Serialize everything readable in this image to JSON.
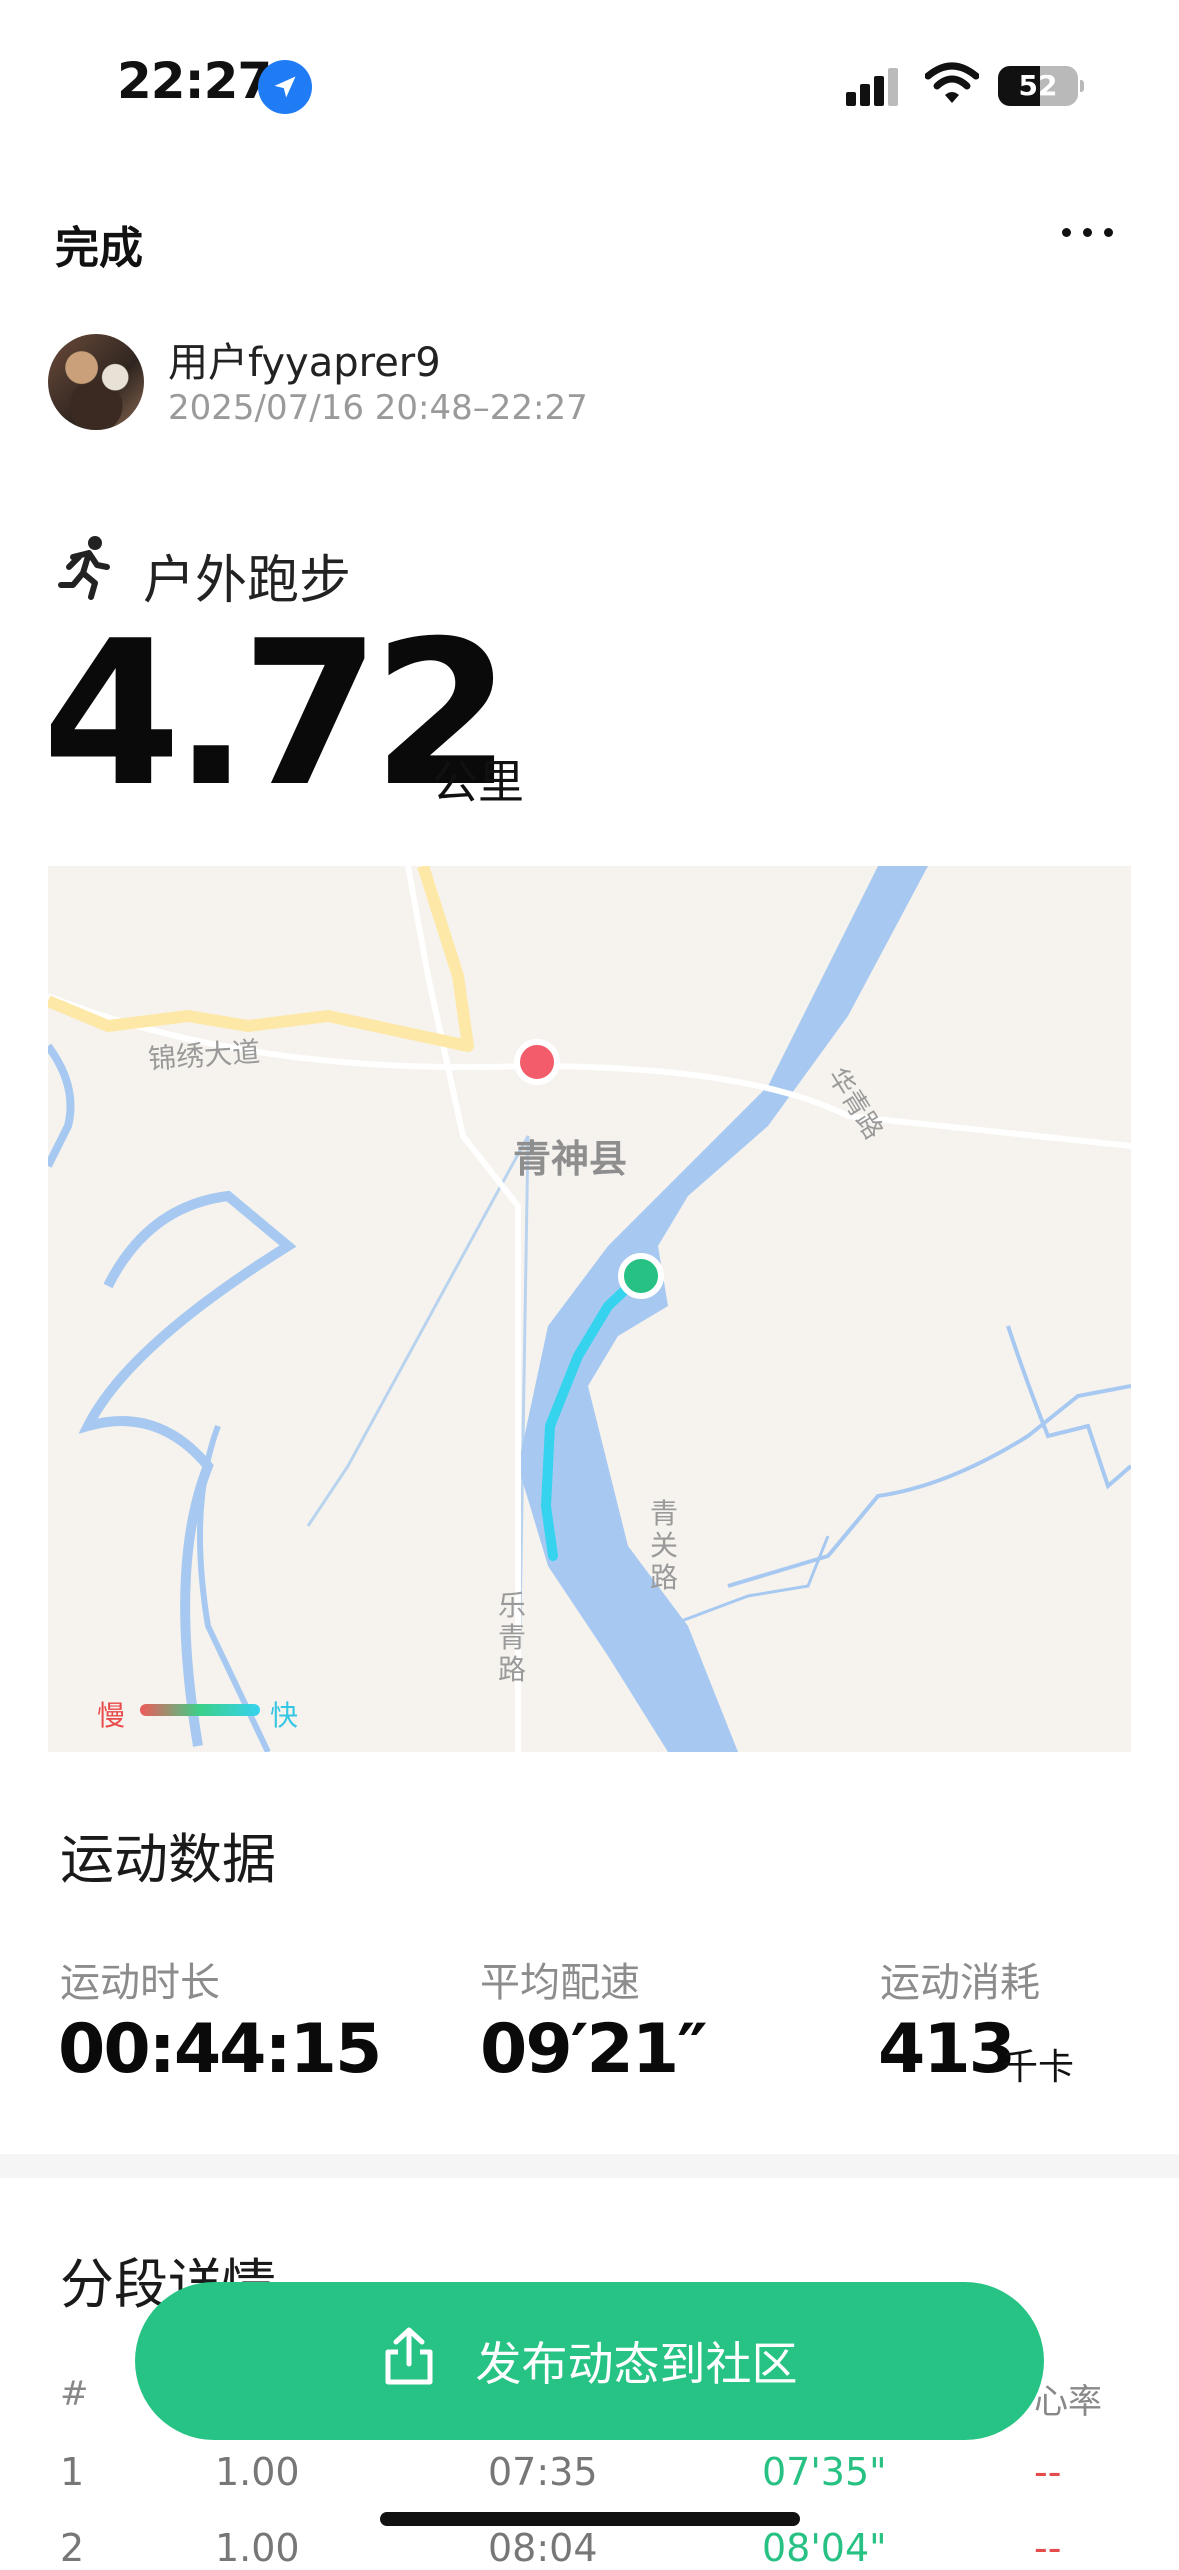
{
  "status_bar": {
    "time": "22:27",
    "battery": "52"
  },
  "header": {
    "done_label": "完成",
    "more_icon": "more-horizontal-icon"
  },
  "user": {
    "name": "用户fyyaprer9",
    "time_range": "2025/07/16 20:48–22:27"
  },
  "activity": {
    "type": "户外跑步",
    "distance": "4.72",
    "distance_unit": "公里"
  },
  "map": {
    "labels": {
      "road_1": "锦绣大道",
      "town": "青神县",
      "road_2": "华青路",
      "road_3": "青关路",
      "road_4": "乐青路"
    },
    "legend": {
      "slow": "慢",
      "fast": "快"
    },
    "colors": {
      "start": "#27c183",
      "end": "#f35c6a",
      "route": "#35d3ee",
      "water": "#a7c9f1"
    }
  },
  "stats": {
    "title": "运动数据",
    "duration_label": "运动时长",
    "duration": "00:44:15",
    "pace_label": "平均配速",
    "pace": "09′21″",
    "calories_label": "运动消耗",
    "calories": "413",
    "calories_unit": "千卡"
  },
  "splits": {
    "title": "分段详情",
    "header_index": "#",
    "header_hr": "心率",
    "rows": [
      {
        "index": "1",
        "km": "1.00",
        "time": "07:35",
        "pace": "07'35\"",
        "hr": "--"
      },
      {
        "index": "2",
        "km": "1.00",
        "time": "08:04",
        "pace": "08'04\"",
        "hr": "--"
      }
    ]
  },
  "publish": {
    "label": "发布动态到社区"
  }
}
